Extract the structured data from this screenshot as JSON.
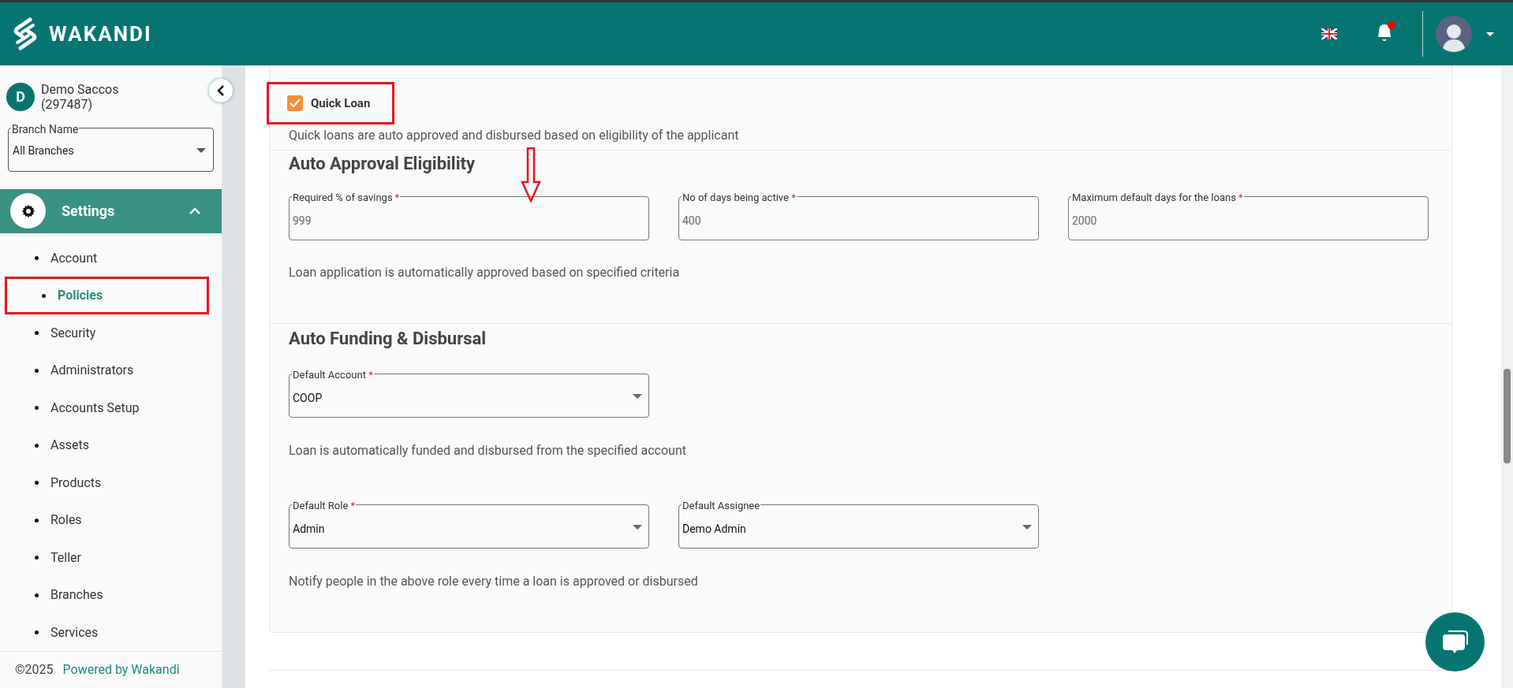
{
  "header": {
    "brand": "WAKANDI",
    "notifications": {
      "unread": true
    }
  },
  "sidebar": {
    "organization": {
      "initial": "D",
      "name": "Demo Saccos",
      "code": "(297487)"
    },
    "branch_select": {
      "label": "Branch Name",
      "value": "All Branches"
    },
    "section": {
      "label": "Settings",
      "expanded": true
    },
    "items": [
      {
        "label": "Account",
        "selected": false
      },
      {
        "label": "Policies",
        "selected": true
      },
      {
        "label": "Security",
        "selected": false
      },
      {
        "label": "Administrators",
        "selected": false
      },
      {
        "label": "Accounts Setup",
        "selected": false
      },
      {
        "label": "Assets",
        "selected": false
      },
      {
        "label": "Products",
        "selected": false
      },
      {
        "label": "Roles",
        "selected": false
      },
      {
        "label": "Teller",
        "selected": false
      },
      {
        "label": "Branches",
        "selected": false
      },
      {
        "label": "Services",
        "selected": false
      }
    ],
    "footer": {
      "copyright": "©2025",
      "link": "Powered by Wakandi"
    }
  },
  "quick_loan": {
    "label": "Quick Loan",
    "checked": true,
    "description": "Quick loans are auto approved and disbursed based on eligibility of the applicant"
  },
  "auto_approval": {
    "title": "Auto Approval Eligibility",
    "fields": [
      {
        "label": "Required % of savings",
        "required_mark": "*",
        "value": "999"
      },
      {
        "label": "No of days being active",
        "required_mark": "*",
        "value": "400"
      },
      {
        "label": "Maximum default days for the loans",
        "required_mark": "*",
        "value": "2000"
      }
    ],
    "note": "Loan application is automatically approved based on specified criteria"
  },
  "auto_funding": {
    "title": "Auto Funding & Disbursal",
    "account_select": {
      "label": "Default Account",
      "required_mark": "*",
      "value": "COOP"
    },
    "account_note": "Loan is automatically funded and disbursed from the specified account",
    "selects": [
      {
        "label": "Default Role",
        "required_mark": "*",
        "value": "Admin"
      },
      {
        "label": "Default Assignee",
        "value": "Demo Admin"
      }
    ],
    "note": "Notify people in the above role every time a loan is approved or disbursed"
  }
}
